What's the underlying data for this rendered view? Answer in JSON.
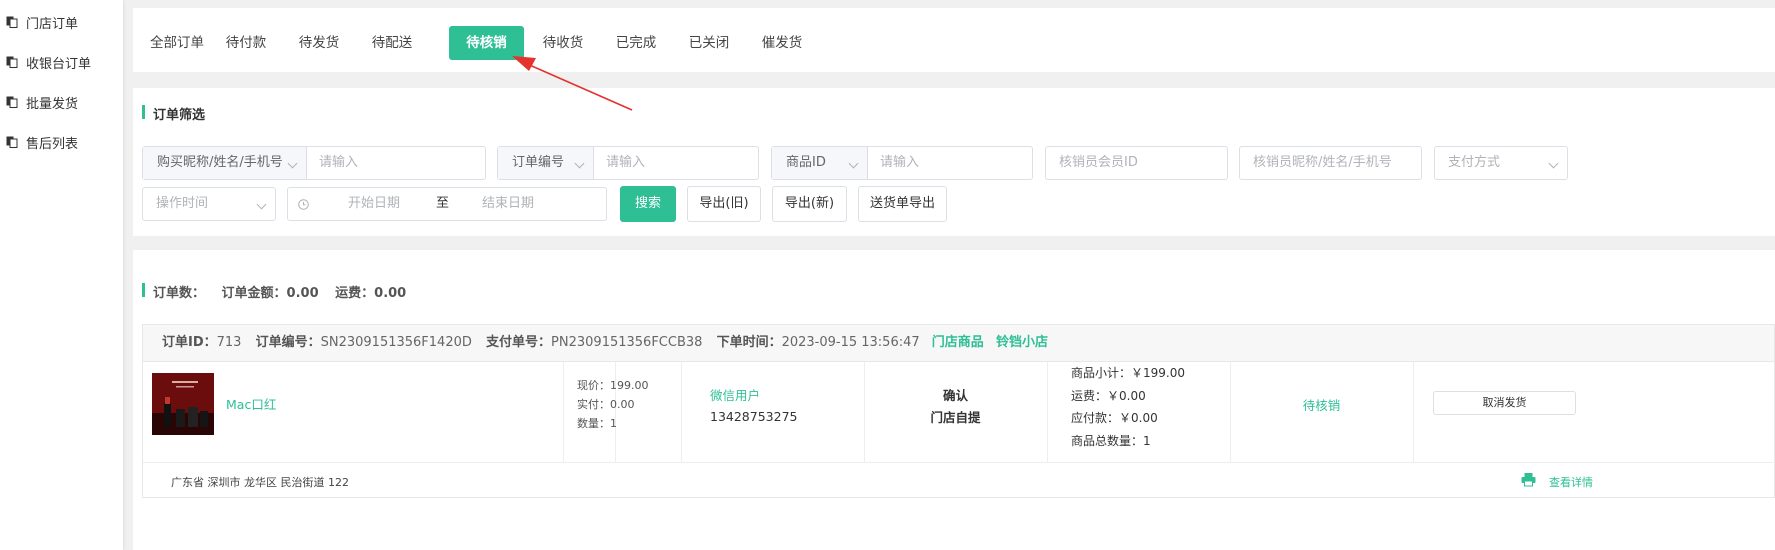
{
  "sidebar": {
    "items": [
      {
        "label": "门店订单",
        "icon": "copy-icon"
      },
      {
        "label": "收银台订单",
        "icon": "copy-icon"
      },
      {
        "label": "批量发货",
        "icon": "copy-icon"
      },
      {
        "label": "售后列表",
        "icon": "copy-icon"
      }
    ]
  },
  "tabs": [
    "全部订单",
    "待付款",
    "待发货",
    "待配送",
    "待核销",
    "待收货",
    "已完成",
    "已关闭",
    "催发货"
  ],
  "active_tab": "待核销",
  "filter": {
    "title": "订单筛选",
    "buyer_select": "购买昵称/姓名/手机号",
    "buyer_placeholder": "请输入",
    "order_no_select": "订单编号",
    "order_no_placeholder": "请输入",
    "product_id_select": "商品ID",
    "product_id_placeholder": "请输入",
    "verifier_id_placeholder": "核销员会员ID",
    "verifier_name_placeholder": "核销员昵称/姓名/手机号",
    "payment_placeholder": "支付方式",
    "op_time_placeholder": "操作时间",
    "start_date_placeholder": "开始日期",
    "date_separator": "至",
    "end_date_placeholder": "结束日期",
    "search_label": "搜索",
    "export_old_label": "导出(旧)",
    "export_new_label": "导出(新)",
    "delivery_export_label": "送货单导出"
  },
  "summary": {
    "count_label": "订单数：",
    "amount_label": "订单金额：0.00",
    "shipping_label": "运费：0.00"
  },
  "order": {
    "id_label": "订单ID：",
    "id": "713",
    "no_label": "订单编号：",
    "no": "SN2309151356F1420D",
    "pay_no_label": "支付单号：",
    "pay_no": "PN2309151356FCCB38",
    "time_label": "下单时间：",
    "time": "2023-09-15 13:56:47",
    "tag_store_goods": "门店商品",
    "tag_shop": "铃铛小店",
    "product_name": "Mac口红",
    "price_now": "现价：199.00",
    "price_paid": "实付：0.00",
    "quantity": "数量：1",
    "user_type": "微信用户",
    "user_phone": "13428753275",
    "delivery_status": "确认",
    "delivery_method": "门店自提",
    "subtotal": "商品小计：￥199.00",
    "shipping": "运费：￥0.00",
    "payable": "应付款：￥0.00",
    "total_qty": "商品总数量：1",
    "status": "待核销",
    "cancel_label": "取消发货",
    "address": "广东省 深圳市 龙华区 民治街道 122",
    "detail_label": "查看详情"
  },
  "colors": {
    "accent": "#2ebf95",
    "annotation": "#e5322d"
  }
}
